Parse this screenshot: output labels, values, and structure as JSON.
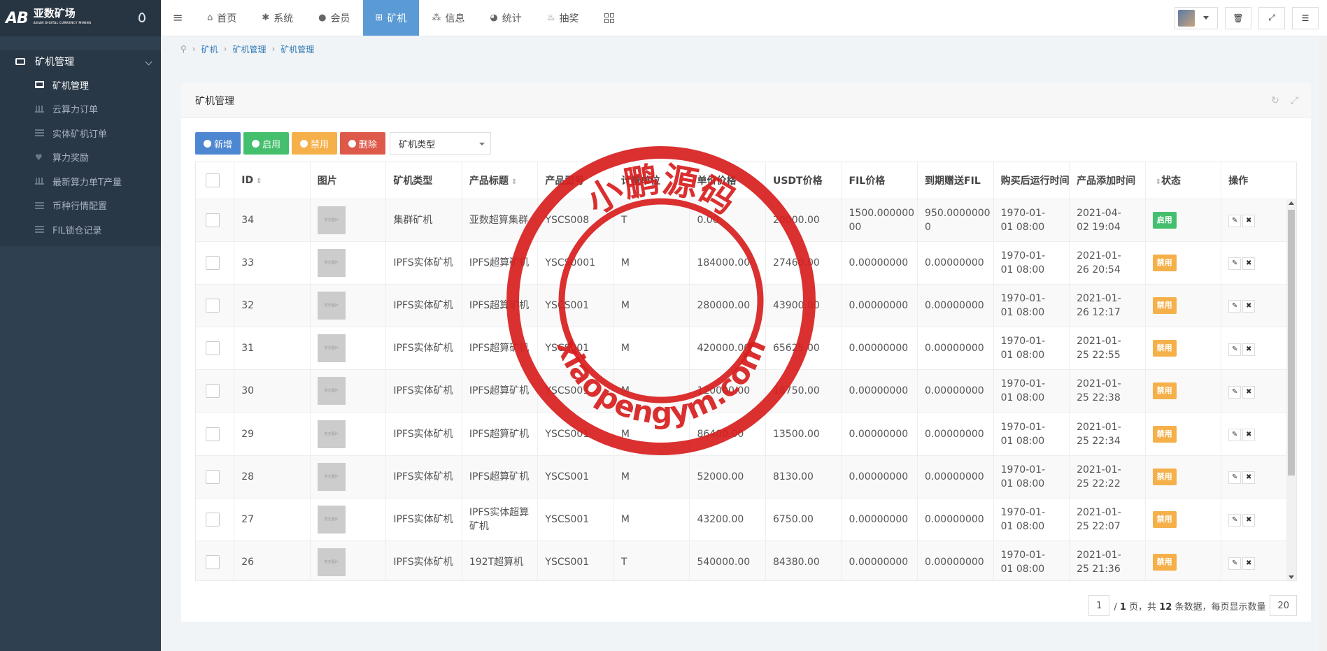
{
  "brand": {
    "mark": "AB",
    "name": "亚数矿场",
    "sub": "ASIAN DIGITAL CURRENCY MINING"
  },
  "sidebar": {
    "section": "矿机管理",
    "items": [
      {
        "label": "矿机管理",
        "icon": "monitor-icon",
        "active": true
      },
      {
        "label": "云算力订单",
        "icon": "bar-chart-icon"
      },
      {
        "label": "实体矿机订单",
        "icon": "list-icon"
      },
      {
        "label": "算力奖励",
        "icon": "heart-icon"
      },
      {
        "label": "最新算力单T产量",
        "icon": "signal-icon"
      },
      {
        "label": "币种行情配置",
        "icon": "table-icon"
      },
      {
        "label": "FIL锁仓记录",
        "icon": "list-icon"
      }
    ]
  },
  "topnav": {
    "tabs": [
      {
        "label": "首页",
        "icon": "home-icon"
      },
      {
        "label": "系统",
        "icon": "gear-icon"
      },
      {
        "label": "会员",
        "icon": "user-icon"
      },
      {
        "label": "矿机",
        "icon": "windows-icon",
        "active": true
      },
      {
        "label": "信息",
        "icon": "share-icon"
      },
      {
        "label": "统计",
        "icon": "pie-icon"
      },
      {
        "label": "抽奖",
        "icon": "gift-icon"
      }
    ]
  },
  "breadcrumb": [
    "矿机",
    "矿机管理",
    "矿机管理"
  ],
  "panel": {
    "title": "矿机管理"
  },
  "toolbar": {
    "add": "新增",
    "enable": "启用",
    "disable": "禁用",
    "delete": "删除",
    "type_select": "矿机类型"
  },
  "table": {
    "headers": [
      "ID",
      "图片",
      "矿机类型",
      "产品标题",
      "产品型号",
      "计量单位",
      "单价价格",
      "USDT价格",
      "FIL价格",
      "到期赠送FIL",
      "购买后运行时间",
      "产品添加时间",
      "状态",
      "操作"
    ],
    "thumb_text": "暂无图片",
    "rows": [
      {
        "id": "34",
        "type": "集群矿机",
        "title": "亚数超算集群",
        "model": "YSCS008",
        "unit": "T",
        "price": "0.00",
        "usdt": "20000.00",
        "fil": "1500.00000000",
        "gift": "950.00000000",
        "run": "1970-01-01 08:00",
        "added": "2021-04-02 19:04",
        "status": "启用",
        "on": true
      },
      {
        "id": "33",
        "type": "IPFS实体矿机",
        "title": "IPFS超算矿机",
        "model": "YSCS0001",
        "unit": "M",
        "price": "184000.00",
        "usdt": "27460.00",
        "fil": "0.00000000",
        "gift": "0.00000000",
        "run": "1970-01-01 08:00",
        "added": "2021-01-26 20:54",
        "status": "禁用",
        "on": false
      },
      {
        "id": "32",
        "type": "IPFS实体矿机",
        "title": "IPFS超算矿机",
        "model": "YSCS001",
        "unit": "M",
        "price": "280000.00",
        "usdt": "43900.00",
        "fil": "0.00000000",
        "gift": "0.00000000",
        "run": "1970-01-01 08:00",
        "added": "2021-01-26 12:17",
        "status": "禁用",
        "on": false
      },
      {
        "id": "31",
        "type": "IPFS实体矿机",
        "title": "IPFS超算矿机",
        "model": "YSCS001",
        "unit": "M",
        "price": "420000.00",
        "usdt": "65625.00",
        "fil": "0.00000000",
        "gift": "0.00000000",
        "run": "1970-01-01 08:00",
        "added": "2021-01-25 22:55",
        "status": "禁用",
        "on": false
      },
      {
        "id": "30",
        "type": "IPFS实体矿机",
        "title": "IPFS超算矿机",
        "model": "YSCS001",
        "unit": "M",
        "price": "120000.00",
        "usdt": "18750.00",
        "fil": "0.00000000",
        "gift": "0.00000000",
        "run": "1970-01-01 08:00",
        "added": "2021-01-25 22:38",
        "status": "禁用",
        "on": false
      },
      {
        "id": "29",
        "type": "IPFS实体矿机",
        "title": "IPFS超算矿机",
        "model": "YSCS001",
        "unit": "M",
        "price": "86400.00",
        "usdt": "13500.00",
        "fil": "0.00000000",
        "gift": "0.00000000",
        "run": "1970-01-01 08:00",
        "added": "2021-01-25 22:34",
        "status": "禁用",
        "on": false
      },
      {
        "id": "28",
        "type": "IPFS实体矿机",
        "title": "IPFS超算矿机",
        "model": "YSCS001",
        "unit": "M",
        "price": "52000.00",
        "usdt": "8130.00",
        "fil": "0.00000000",
        "gift": "0.00000000",
        "run": "1970-01-01 08:00",
        "added": "2021-01-25 22:22",
        "status": "禁用",
        "on": false
      },
      {
        "id": "27",
        "type": "IPFS实体矿机",
        "title": "IPFS实体超算矿机",
        "model": "YSCS001",
        "unit": "M",
        "price": "43200.00",
        "usdt": "6750.00",
        "fil": "0.00000000",
        "gift": "0.00000000",
        "run": "1970-01-01 08:00",
        "added": "2021-01-25 22:07",
        "status": "禁用",
        "on": false
      },
      {
        "id": "26",
        "type": "IPFS实体矿机",
        "title": "192T超算机",
        "model": "YSCS001",
        "unit": "T",
        "price": "540000.00",
        "usdt": "84380.00",
        "fil": "0.00000000",
        "gift": "0.00000000",
        "run": "1970-01-01 08:00",
        "added": "2021-01-25 21:36",
        "status": "禁用",
        "on": false
      }
    ]
  },
  "pager": {
    "page": "1",
    "total_pages": "1",
    "page_word": "页，共",
    "count": "12",
    "count_suffix": "条数据，每页显示数量",
    "page_size": "20"
  },
  "watermark": {
    "top": "小鹏源码",
    "bottom": "xiaopengym.com",
    "color": "#d81e1e"
  }
}
